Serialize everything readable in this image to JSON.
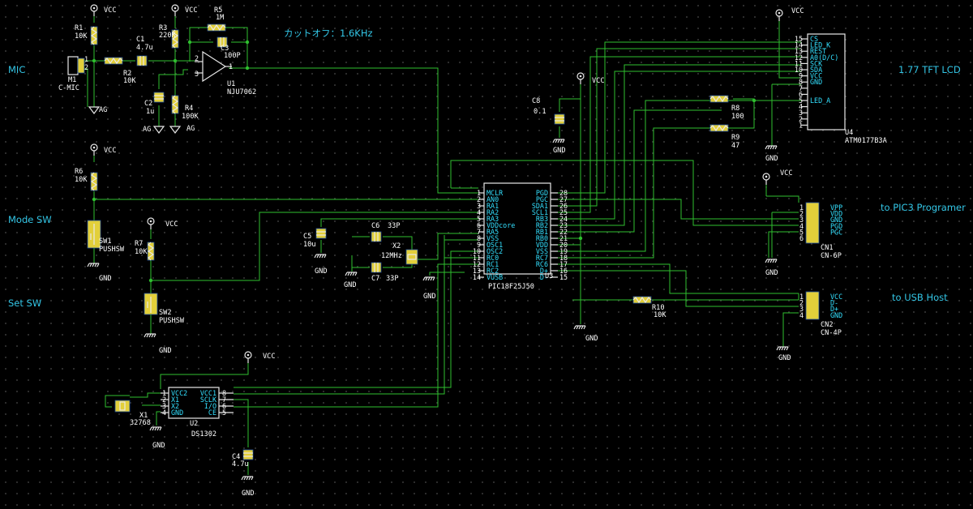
{
  "annotations": {
    "mic": "MIC",
    "mode_sw": "Mode SW",
    "set_sw": "Set SW",
    "cutoff": "カットオフ：1.6KHz",
    "tft": "1.77 TFT LCD",
    "pickit": "to PIC3 Programer",
    "usb": "to USB Host"
  },
  "nets": {
    "vcc": "VCC",
    "gnd": "GND",
    "ag": "AG"
  },
  "parts": {
    "R1": {
      "ref": "R1",
      "value": "10K"
    },
    "R2": {
      "ref": "R2",
      "value": "10K"
    },
    "R3": {
      "ref": "R3",
      "value": "220K"
    },
    "R4": {
      "ref": "R4",
      "value": "100K"
    },
    "R5": {
      "ref": "R5",
      "value": "1M"
    },
    "R6": {
      "ref": "R6",
      "value": "10K"
    },
    "R7": {
      "ref": "R7",
      "value": "10K"
    },
    "R8": {
      "ref": "R8",
      "value": "100"
    },
    "R9": {
      "ref": "R9",
      "value": "47"
    },
    "R10": {
      "ref": "R10",
      "value": "10K"
    },
    "C1": {
      "ref": "C1",
      "value": "4.7u"
    },
    "C2": {
      "ref": "C2",
      "value": "1u"
    },
    "C3": {
      "ref": "C3",
      "value": "100P"
    },
    "C4": {
      "ref": "C4",
      "value": "4.7u"
    },
    "C5": {
      "ref": "C5",
      "value": "10u"
    },
    "C6": {
      "ref": "C6",
      "value": "33P"
    },
    "C7": {
      "ref": "C7",
      "value": "33P"
    },
    "C8": {
      "ref": "C8",
      "value": "0.1"
    },
    "M1": {
      "ref": "M1",
      "value": "C-MIC"
    },
    "U1": {
      "ref": "U1",
      "value": "NJU7062"
    },
    "SW1": {
      "ref": "SW1",
      "value": "PUSHSW"
    },
    "SW2": {
      "ref": "SW2",
      "value": "PUSHSW"
    },
    "X1": {
      "ref": "X1",
      "value": "32768"
    },
    "X2": {
      "ref": "X2",
      "value": "12MHz"
    },
    "U2": {
      "ref": "U2",
      "value": "DS1302"
    },
    "U3": {
      "ref": "U3",
      "value": "PIC18F25J50"
    },
    "U4": {
      "ref": "U4",
      "value": "ATM0177B3A"
    },
    "CN1": {
      "ref": "CN1",
      "value": "CN-6P"
    },
    "CN2": {
      "ref": "CN2",
      "value": "CN-4P"
    }
  },
  "u3": {
    "left": [
      {
        "n": "1",
        "s": "MCLR"
      },
      {
        "n": "2",
        "s": "AN0"
      },
      {
        "n": "3",
        "s": "RA1"
      },
      {
        "n": "4",
        "s": "RA2"
      },
      {
        "n": "5",
        "s": "RA3"
      },
      {
        "n": "6",
        "s": "VDDcore"
      },
      {
        "n": "7",
        "s": "RA5"
      },
      {
        "n": "8",
        "s": "VSS"
      },
      {
        "n": "9",
        "s": "OSC1"
      },
      {
        "n": "10",
        "s": "OSC2"
      },
      {
        "n": "11",
        "s": "RC0"
      },
      {
        "n": "12",
        "s": "RC1"
      },
      {
        "n": "13",
        "s": "RC2"
      },
      {
        "n": "14",
        "s": "VUSB"
      }
    ],
    "right": [
      {
        "n": "28",
        "s": "PGD"
      },
      {
        "n": "27",
        "s": "PGC"
      },
      {
        "n": "26",
        "s": "SDA1"
      },
      {
        "n": "25",
        "s": "SCL1"
      },
      {
        "n": "24",
        "s": "RB3"
      },
      {
        "n": "23",
        "s": "RB2"
      },
      {
        "n": "22",
        "s": "RB1"
      },
      {
        "n": "21",
        "s": "RB0"
      },
      {
        "n": "20",
        "s": "VDD"
      },
      {
        "n": "19",
        "s": "VSS"
      },
      {
        "n": "18",
        "s": "RC7"
      },
      {
        "n": "17",
        "s": "RC6"
      },
      {
        "n": "16",
        "s": "D+"
      },
      {
        "n": "15",
        "s": "D-"
      }
    ]
  },
  "u2": {
    "left": [
      {
        "n": "1",
        "s": "VCC2"
      },
      {
        "n": "2",
        "s": "X1"
      },
      {
        "n": "3",
        "s": "X2"
      },
      {
        "n": "4",
        "s": "GND"
      }
    ],
    "right": [
      {
        "n": "8",
        "s": "VCC1"
      },
      {
        "n": "7",
        "s": "SCLK"
      },
      {
        "n": "6",
        "s": "I/O"
      },
      {
        "n": "5",
        "s": "CE"
      }
    ]
  },
  "u4": {
    "pins": [
      {
        "n": "15",
        "s": "CS"
      },
      {
        "n": "14",
        "s": "LED_K"
      },
      {
        "n": "13",
        "s": "REST"
      },
      {
        "n": "12",
        "s": "A0(D/C)"
      },
      {
        "n": "11",
        "s": "SCK"
      },
      {
        "n": "10",
        "s": "SDA"
      },
      {
        "n": "9",
        "s": "VCC"
      },
      {
        "n": "8",
        "s": "GND"
      },
      {
        "n": "7",
        "s": ""
      },
      {
        "n": "6",
        "s": ""
      },
      {
        "n": "5",
        "s": "LED_A"
      },
      {
        "n": "4",
        "s": ""
      },
      {
        "n": "3",
        "s": ""
      },
      {
        "n": "2",
        "s": ""
      },
      {
        "n": "1",
        "s": ""
      }
    ]
  },
  "cn1": {
    "pins": [
      {
        "n": "1",
        "s": "VPP"
      },
      {
        "n": "2",
        "s": "VDD"
      },
      {
        "n": "3",
        "s": "GND"
      },
      {
        "n": "4",
        "s": "PGD"
      },
      {
        "n": "5",
        "s": "PGC"
      },
      {
        "n": "6",
        "s": ""
      }
    ]
  },
  "cn2": {
    "pins": [
      {
        "n": "1",
        "s": "VCC"
      },
      {
        "n": "2",
        "s": "D-"
      },
      {
        "n": "3",
        "s": "D+"
      },
      {
        "n": "4",
        "s": "GND"
      }
    ]
  },
  "u1_pins": {
    "p1": "1",
    "p2": "2",
    "p3": "3"
  },
  "m1_pins": {
    "p1": "1",
    "p2": "2"
  }
}
